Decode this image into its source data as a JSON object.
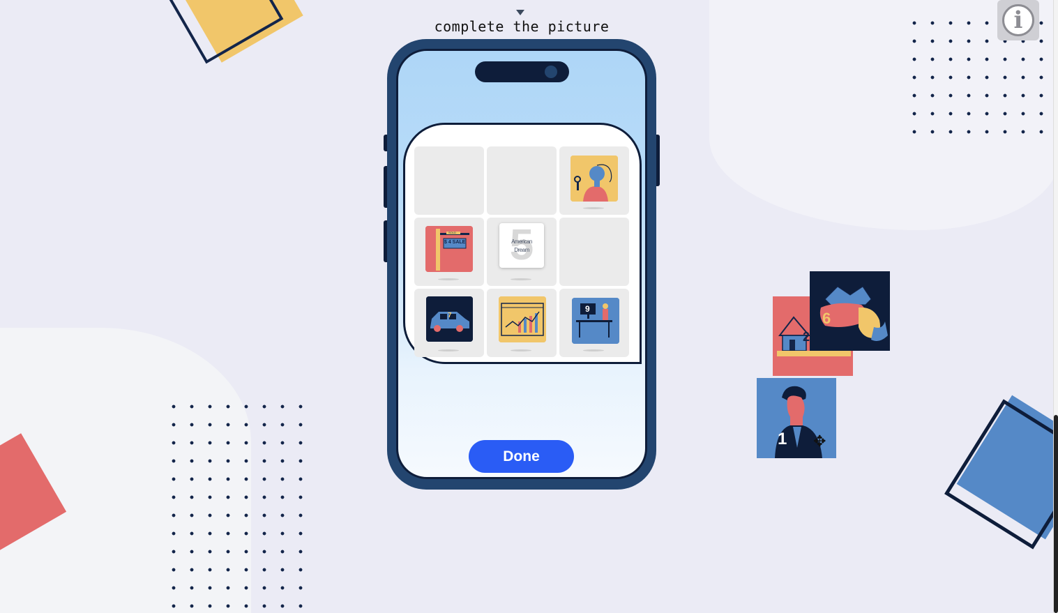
{
  "header": {
    "instruction": "complete the picture"
  },
  "info_button": {
    "glyph": "i"
  },
  "done_button": {
    "label": "Done"
  },
  "board": {
    "cells": [
      {
        "piece": null
      },
      {
        "piece": null
      },
      {
        "piece": "woman-with-key",
        "number": ""
      },
      {
        "piece": "sold-sign",
        "number": ""
      },
      {
        "piece": "american-dream-card",
        "number": "5",
        "text": "American Dream"
      },
      {
        "piece": null
      },
      {
        "piece": "blue-car",
        "number": "7"
      },
      {
        "piece": "growth-chart",
        "number": ""
      },
      {
        "piece": "person-at-desk",
        "number": "9"
      }
    ],
    "sold_sign_text": "$ 4 SALE",
    "sold_label": "SOLD"
  },
  "loose_pieces": [
    {
      "piece": "house",
      "number": "2"
    },
    {
      "piece": "hand-with-money",
      "number": "6"
    },
    {
      "piece": "businessman",
      "number": "1"
    }
  ],
  "colors": {
    "background": "#ebebf5",
    "navy": "#0e1d3a",
    "yellow": "#f1c66a",
    "red": "#e36b6b",
    "blue": "#5589c7",
    "done": "#2a5cf5"
  }
}
